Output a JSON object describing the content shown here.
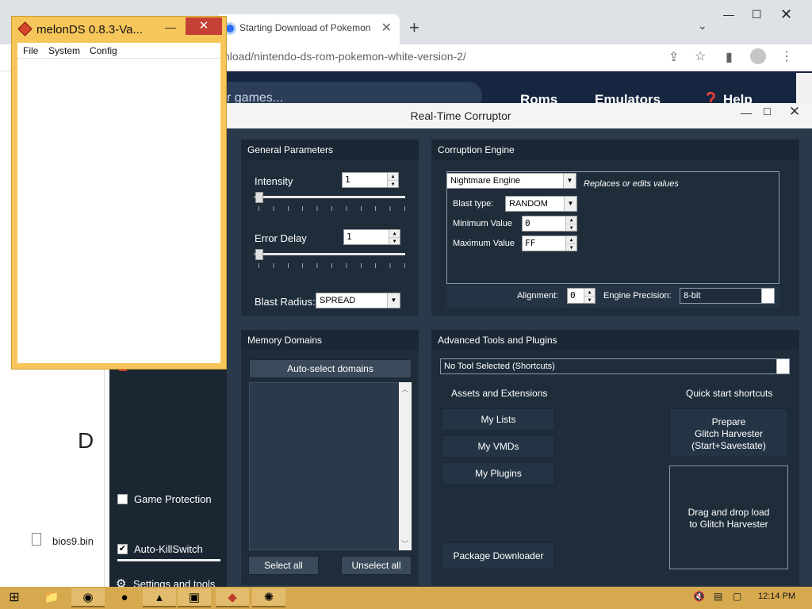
{
  "chrome": {
    "tab_title": "Starting Download of Pokemon",
    "new_tab": "+",
    "address": "nload/nintendo-ds-rom-pokemon-white-version-2/",
    "site_search_placeholder": "r games...",
    "nav": {
      "roms": "Roms",
      "emulators": "Emulators",
      "help": "Help"
    },
    "left_panel": {
      "partial_heading": "D",
      "file_label": "bios9.bin"
    }
  },
  "melonds": {
    "title": "melonDS 0.8.3-Va...",
    "menu": {
      "file": "File",
      "system": "System",
      "config": "Config"
    }
  },
  "rtc": {
    "title": "Real-Time Corruptor",
    "general": {
      "header": "General Parameters",
      "intensity_label": "Intensity",
      "intensity_value": "1",
      "error_delay_label": "Error Delay",
      "error_delay_value": "1",
      "blast_radius_label": "Blast Radius:",
      "blast_radius_value": "SPREAD"
    },
    "engine": {
      "header": "Corruption Engine",
      "engine_value": "Nightmare Engine",
      "engine_desc": "Replaces or edits values",
      "blast_type_label": "Blast type:",
      "blast_type_value": "RANDOM",
      "min_label": "Minimum Value",
      "min_value": "0",
      "max_label": "Maximum Value",
      "max_value": "FF",
      "alignment_label": "Alignment:",
      "alignment_value": "0",
      "precision_label": "Engine Precision:",
      "precision_value": "8-bit"
    },
    "memory": {
      "header": "Memory Domains",
      "auto_select": "Auto-select domains",
      "select_all": "Select all",
      "unselect_all": "Unselect all"
    },
    "advanced": {
      "header": "Advanced Tools and Plugins",
      "tool_select": "No Tool Selected (Shortcuts)",
      "assets_header": "Assets and Extensions",
      "my_lists": "My Lists",
      "my_vmds": "My VMDs",
      "my_plugins": "My Plugins",
      "package_downloader": "Package Downloader",
      "quick_header": "Quick start shortcuts",
      "prepare_line1": "Prepare",
      "prepare_line2": "Glitch Harvester",
      "prepare_line3": "(Start+Savestate)",
      "dragdrop_line1": "Drag and drop load",
      "dragdrop_line2": "to Glitch Harvester"
    },
    "sidebar": {
      "game_protection": "Game Protection",
      "auto_killswitch": "Auto-KillSwitch",
      "settings_tools": "Settings and tools"
    }
  },
  "taskbar": {
    "time": "12:14 PM"
  }
}
